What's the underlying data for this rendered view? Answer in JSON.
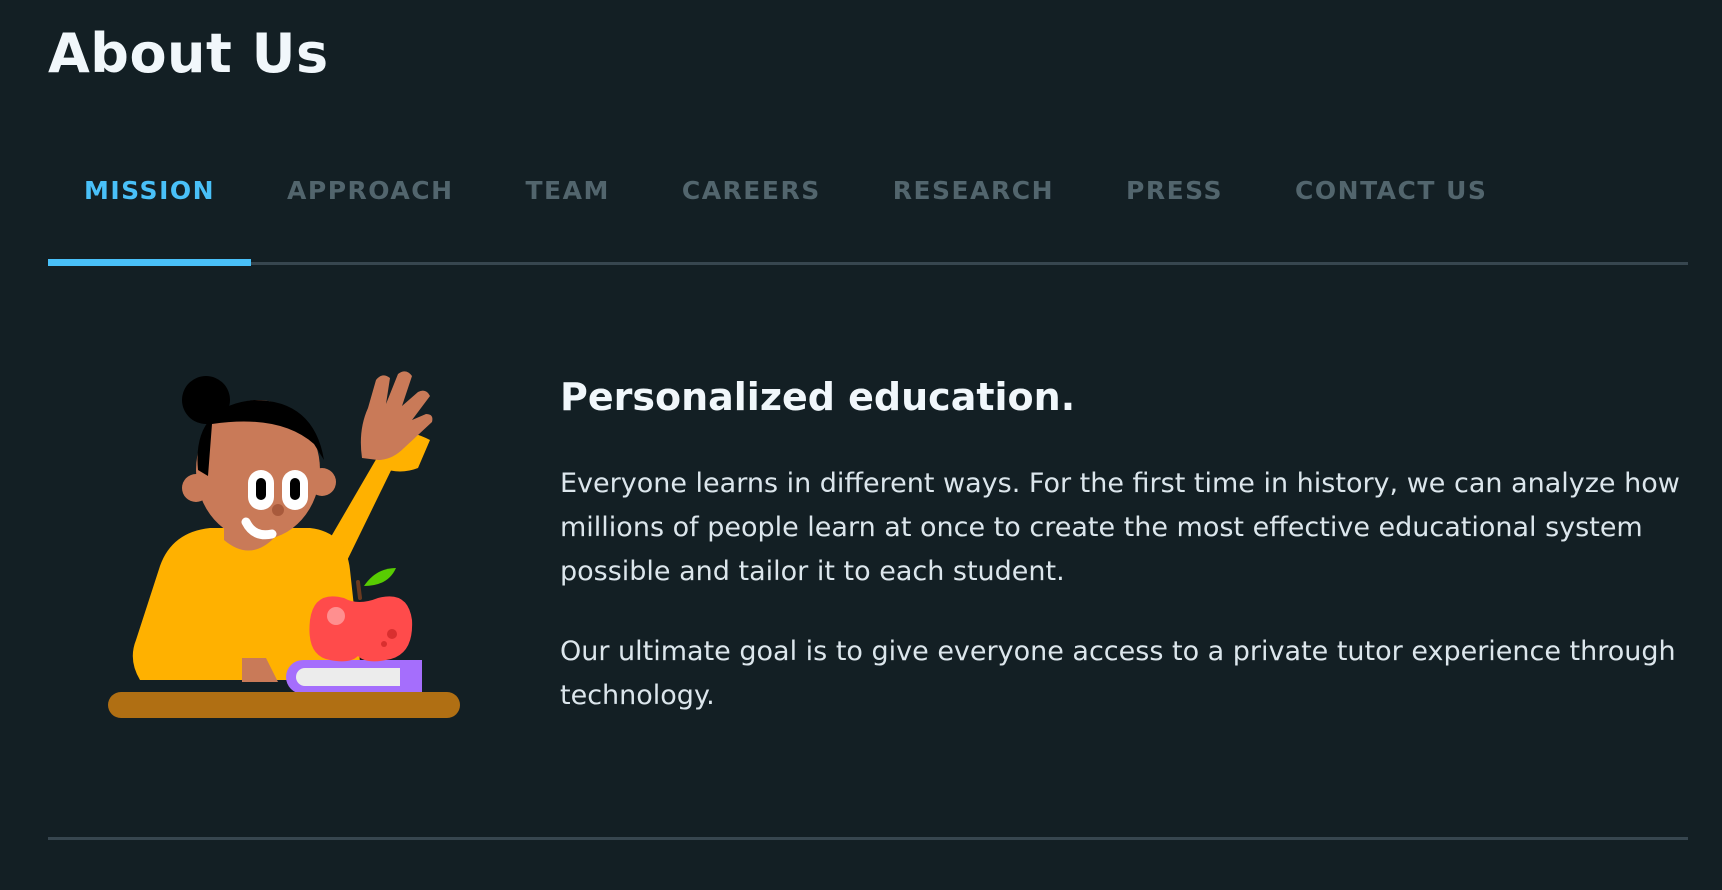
{
  "page": {
    "title": "About Us"
  },
  "tabs": [
    {
      "label": "MISSION",
      "active": true
    },
    {
      "label": "APPROACH",
      "active": false
    },
    {
      "label": "TEAM",
      "active": false
    },
    {
      "label": "CAREERS",
      "active": false
    },
    {
      "label": "RESEARCH",
      "active": false
    },
    {
      "label": "PRESS",
      "active": false
    },
    {
      "label": "CONTACT US",
      "active": false
    }
  ],
  "mission": {
    "heading": "Personalized education.",
    "paragraphs": [
      "Everyone learns in different ways. For the first time in history, we can analyze how millions of people learn at once to create the most effective educational system possible and tailor it to each student.",
      "Our ultimate goal is to give everyone access to a private tutor experience through technology."
    ],
    "illustration_icon": "student-raising-hand-illustration"
  },
  "colors": {
    "background": "#131f24",
    "accent": "#49c0f8",
    "tab_inactive": "#52656d",
    "divider": "#37464f",
    "heading": "#f1f7fb",
    "body_text": "#dce6ec"
  }
}
